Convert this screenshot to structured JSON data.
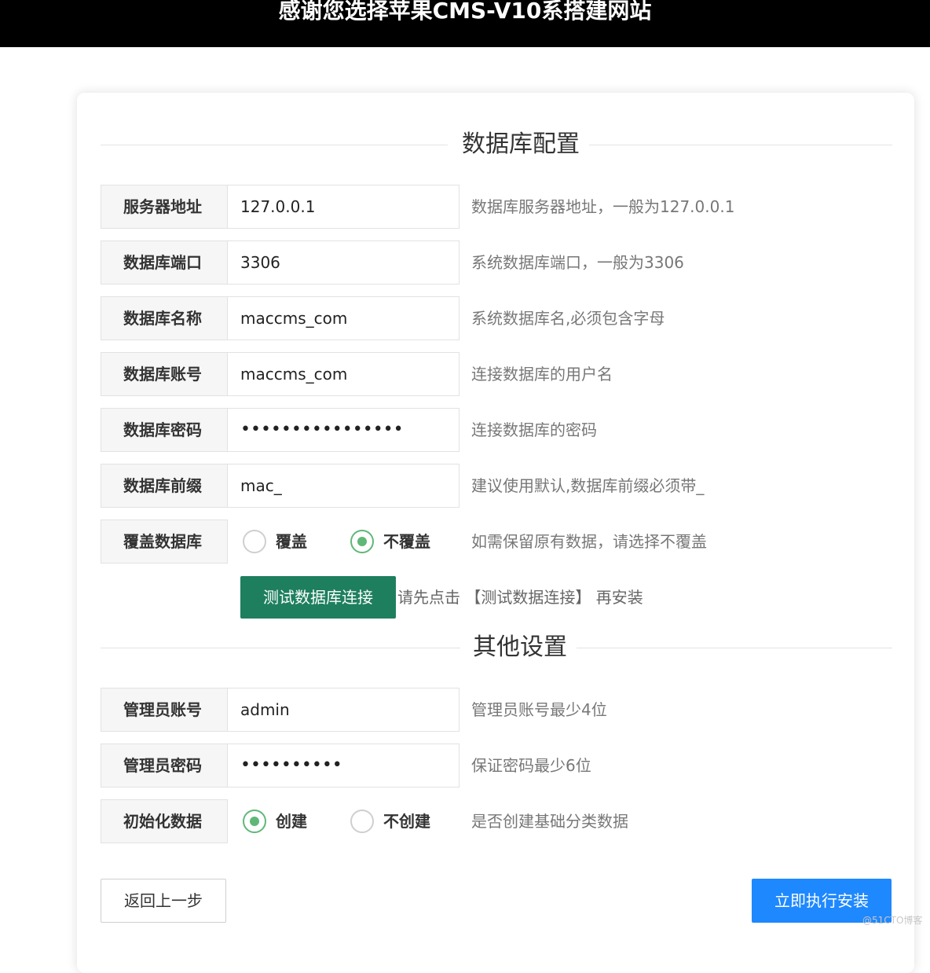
{
  "header": {
    "title": "感谢您选择苹果CMS-V10系搭建网站"
  },
  "db_section": {
    "title": "数据库配置"
  },
  "other_section": {
    "title": "其他设置"
  },
  "fields": {
    "host": {
      "label": "服务器地址",
      "value": "127.0.0.1",
      "hint": "数据库服务器地址，一般为127.0.0.1"
    },
    "port": {
      "label": "数据库端口",
      "value": "3306",
      "hint": "系统数据库端口，一般为3306"
    },
    "name": {
      "label": "数据库名称",
      "value": "maccms_com",
      "hint": "系统数据库名,必须包含字母"
    },
    "user": {
      "label": "数据库账号",
      "value": "maccms_com",
      "hint": "连接数据库的用户名"
    },
    "pass": {
      "label": "数据库密码",
      "value": "••••••••••••••••",
      "hint": "连接数据库的密码"
    },
    "prefix": {
      "label": "数据库前缀",
      "value": "mac_",
      "hint": "建议使用默认,数据库前缀必须带_"
    },
    "cover": {
      "label": "覆盖数据库",
      "option_yes": "覆盖",
      "option_no": "不覆盖",
      "selected": "不覆盖",
      "hint": "如需保留原有数据，请选择不覆盖"
    },
    "admin_user": {
      "label": "管理员账号",
      "value": "admin",
      "hint": "管理员账号最少4位"
    },
    "admin_pass": {
      "label": "管理员密码",
      "value": "••••••••••",
      "hint": "保证密码最少6位"
    },
    "init_data": {
      "label": "初始化数据",
      "option_yes": "创建",
      "option_no": "不创建",
      "selected": "创建",
      "hint": "是否创建基础分类数据"
    }
  },
  "buttons": {
    "test_db": "测试数据库连接",
    "test_hint": "请先点击 【测试数据连接】 再安装",
    "back": "返回上一步",
    "install": "立即执行安装"
  },
  "watermark": "@51CTO博客",
  "colors": {
    "header_bg": "#000000",
    "test_button": "#1e7f5e",
    "install_button": "#1e88ff",
    "radio_checked": "#5fb878"
  }
}
